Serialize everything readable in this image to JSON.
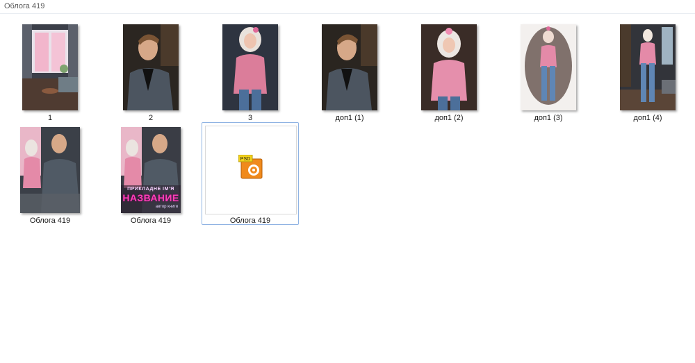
{
  "window": {
    "title": "Облога 419"
  },
  "items": [
    {
      "label": "1",
      "icon": "image-thumbnail-room-window"
    },
    {
      "label": "2",
      "icon": "image-thumbnail-man-portrait"
    },
    {
      "label": "3",
      "icon": "image-thumbnail-woman-pink-sweater"
    },
    {
      "label": "доп1 (1)",
      "icon": "image-thumbnail-man-portrait"
    },
    {
      "label": "доп1 (2)",
      "icon": "image-thumbnail-woman-pink-sweater"
    },
    {
      "label": "доп1 (3)",
      "icon": "image-thumbnail-woman-watercolor"
    },
    {
      "label": "доп1 (4)",
      "icon": "image-thumbnail-woman-room"
    },
    {
      "label": "Облога  419",
      "icon": "image-thumbnail-cover-couple"
    },
    {
      "label": "Облога 419",
      "icon": "image-thumbnail-cover-with-title"
    },
    {
      "label": "Облога 419",
      "icon": "psd-file-icon"
    }
  ],
  "cover": {
    "title_small": "ПРИКЛАДНЕ ІМʼЯ",
    "title_main": "НАЗВАНИЕ",
    "subtitle": "автор книги"
  },
  "psd_icon_text": "PSD",
  "colors": {
    "selection_border": "#8fb3e3",
    "psd_orange": "#f08a1c",
    "psd_tab": "#f3d21b"
  }
}
